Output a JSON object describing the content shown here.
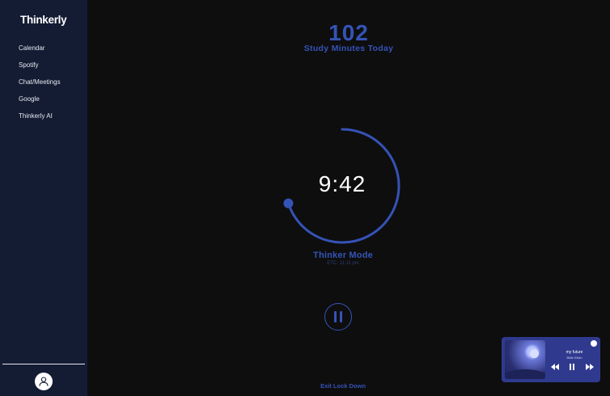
{
  "sidebar": {
    "brand": "Thinkerly",
    "items": [
      {
        "label": "Calendar"
      },
      {
        "label": "Spotify"
      },
      {
        "label": "Chat/Meetings"
      },
      {
        "label": "Google"
      },
      {
        "label": "Thinkerly AI"
      }
    ],
    "profile_icon": "user-icon"
  },
  "stats": {
    "minutes": "102",
    "minutes_label": "Study Minutes Today"
  },
  "timer": {
    "time": "9:42",
    "mode": "Thinker Mode",
    "etc": "ETC: 11:11 pm",
    "progress": 0.7
  },
  "controls": {
    "pause_icon": "pause-icon",
    "exit_label": "Exit Lock Down"
  },
  "player": {
    "title": "my future",
    "artist": "Billie Eilish",
    "logo": "spotify-icon"
  },
  "colors": {
    "accent": "#3553b6",
    "sidebar": "#131c33",
    "background": "#0e0e0f",
    "player": "#2f3a8f"
  }
}
